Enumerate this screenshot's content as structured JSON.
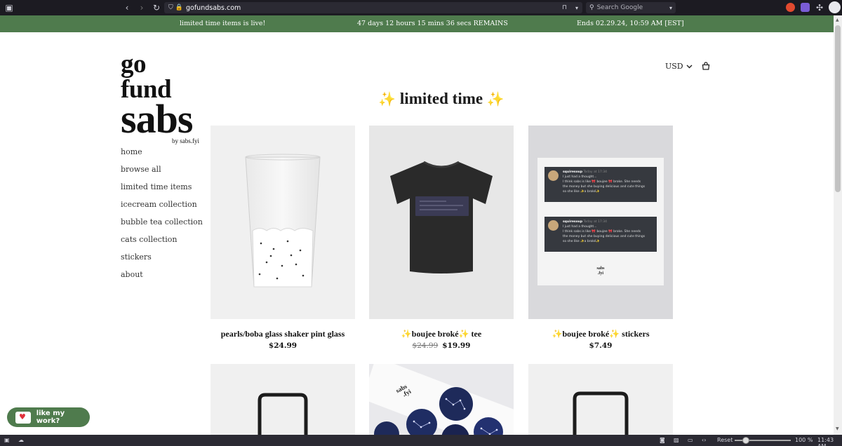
{
  "browser": {
    "url": "gofundsabs.com",
    "search_placeholder": "Search Google"
  },
  "announcement": {
    "left": "limited time items is live!",
    "center": "47 days 12 hours 15 mins 36 secs REMAINS",
    "right": "Ends 02.29.24, 10:59 AM [EST]"
  },
  "logo": {
    "line1": "go fund",
    "line2": "sabs",
    "line3": "by sabs.fyi"
  },
  "header": {
    "currency": "USD",
    "page_title": "limited time",
    "sparkle": "✨"
  },
  "nav": {
    "items": [
      {
        "label": "home"
      },
      {
        "label": "browse all"
      },
      {
        "label": "limited time items"
      },
      {
        "label": "icecream collection"
      },
      {
        "label": "bubble tea collection"
      },
      {
        "label": "cats collection"
      },
      {
        "label": "stickers"
      },
      {
        "label": "about"
      }
    ]
  },
  "products": [
    {
      "title": "pearls/boba glass shaker pint glass",
      "price": "$24.99",
      "old_price": ""
    },
    {
      "title": "✨boujee broké✨ tee",
      "price": "$19.99",
      "old_price": "$24.99"
    },
    {
      "title": "✨boujee broké✨ stickers",
      "price": "$7.49",
      "old_price": ""
    }
  ],
  "sticker_preview": {
    "username": "squiresoup",
    "time": "Today at 17:34",
    "line1": "I just had a thought...",
    "line2": "I think sabs is like 🎀 boujee 🎀 broke. She needs",
    "line3": "the money but she buying delicious and cute things",
    "line4": "so she like ✨a broké✨",
    "brand1": "sabs",
    "brand2": ".fyi"
  },
  "row2_brand": {
    "line1": "sabs",
    "line2": ".fyi"
  },
  "kofi": {
    "label": "like my work?"
  },
  "statusbar": {
    "reset": "Reset",
    "zoom": "100 %",
    "time": "11:43 AM"
  }
}
